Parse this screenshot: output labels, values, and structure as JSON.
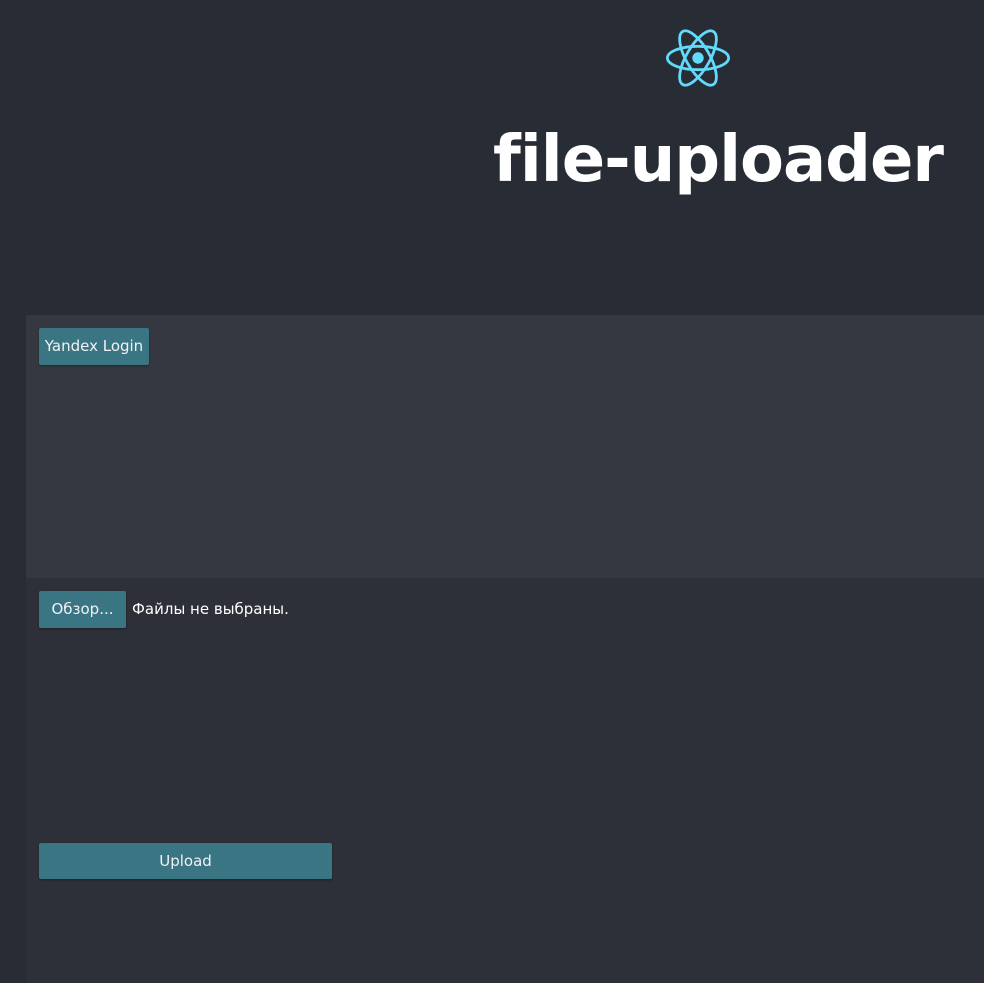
{
  "header": {
    "logo_icon": "react-atom-icon",
    "logo_color": "#61dafb",
    "title": "file-uploader"
  },
  "login_panel": {
    "login_button_label": "Yandex Login"
  },
  "upload_panel": {
    "browse_button_label": "Обзор...",
    "file_status_text": "Файлы не выбраны.",
    "upload_button_label": "Upload"
  },
  "colors": {
    "background": "#282c34",
    "login_panel": "#353841",
    "upload_panel": "#2e3039",
    "button": "#3a7584",
    "text": "#ffffff"
  }
}
